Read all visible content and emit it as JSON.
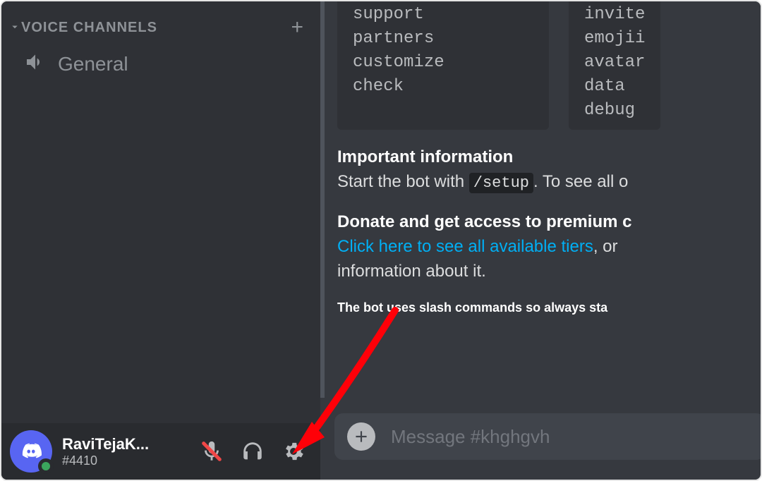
{
  "sidebar": {
    "section_label": "VOICE CHANNELS",
    "add_label": "+",
    "voice_channel": "General"
  },
  "user": {
    "name": "RaviTejaK...",
    "tag": "#4410"
  },
  "commands_left": [
    "support",
    "partners",
    "customize",
    "check"
  ],
  "commands_right": [
    "invite",
    "emojii",
    "avatar",
    "data",
    "debug"
  ],
  "message": {
    "heading1": "Important information",
    "line1_a": "Start the bot with ",
    "line1_code": "/setup",
    "line1_b": ". To see all o",
    "heading2": "Donate and get access to premium c",
    "link": "Click here to see all available tiers",
    "line2_b": ", or ",
    "line3": "information about it.",
    "footer": "The bot uses slash commands so always sta"
  },
  "input": {
    "placeholder": "Message #khghgvh"
  }
}
